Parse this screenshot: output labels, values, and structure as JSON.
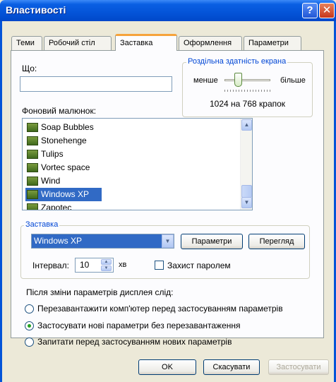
{
  "window": {
    "title": "Властивості",
    "help": "?",
    "close": "✕"
  },
  "tabs": [
    {
      "label": "Теми"
    },
    {
      "label": "Робочий стіл"
    },
    {
      "label": "Заставка"
    },
    {
      "label": "Оформлення"
    },
    {
      "label": "Параметри"
    }
  ],
  "what": {
    "label": "Що:",
    "value": ""
  },
  "resolution": {
    "legend": "Роздільна здатність екрана",
    "less": "менше",
    "more": "більше",
    "value_text": "1024 на 768 крапок"
  },
  "wallpaper": {
    "label": "Фоновий малюнок:",
    "items": [
      "Soap Bubbles",
      "Stonehenge",
      "Tulips",
      "Vortec space",
      "Wind",
      "Windows XP",
      "Zapotec"
    ],
    "selected": "Windows XP"
  },
  "screensaver": {
    "legend": "Заставка",
    "selected": "Windows XP",
    "params_button": "Параметри",
    "preview_button": "Перегляд",
    "interval_label": "Інтервал:",
    "interval_value": "10",
    "interval_unit": "хв",
    "password_label": "Захист паролем"
  },
  "after_change": {
    "label": "Після зміни параметрів дисплея слід:",
    "options": [
      "Перезавантажити комп'ютер перед застосуванням параметрів",
      "Застосувати нові параметри без перезавантаження",
      "Запитати перед застосуванням нових параметрів"
    ],
    "selected_index": 1
  },
  "buttons": {
    "ok": "OK",
    "cancel": "Скасувати",
    "apply": "Застосувати"
  }
}
